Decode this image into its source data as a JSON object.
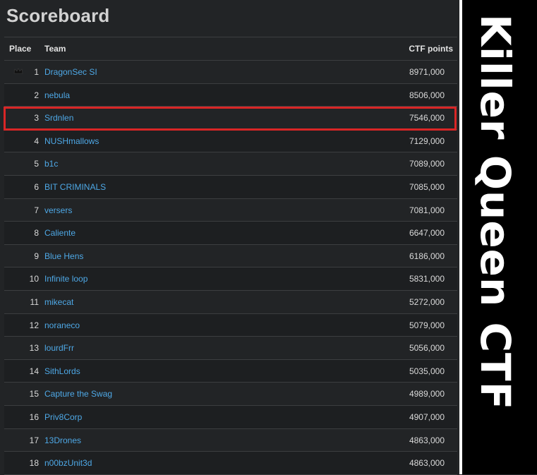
{
  "scoreboard": {
    "title": "Scoreboard",
    "columns": {
      "place": "Place",
      "team": "Team",
      "points": "CTF points"
    },
    "rows": [
      {
        "place": "1",
        "team": "DragonSec SI",
        "points": "8971,000",
        "leader": true
      },
      {
        "place": "2",
        "team": "nebula",
        "points": "8506,000"
      },
      {
        "place": "3",
        "team": "Srdnlen",
        "points": "7546,000",
        "highlighted": true
      },
      {
        "place": "4",
        "team": "NUSHmallows",
        "points": "7129,000"
      },
      {
        "place": "5",
        "team": "b1c",
        "points": "7089,000"
      },
      {
        "place": "6",
        "team": "BIT CRIMINALS",
        "points": "7085,000"
      },
      {
        "place": "7",
        "team": "versers",
        "points": "7081,000"
      },
      {
        "place": "8",
        "team": "Caliente",
        "points": "6647,000"
      },
      {
        "place": "9",
        "team": "Blue Hens",
        "points": "6186,000"
      },
      {
        "place": "10",
        "team": "Infinite loop",
        "points": "5831,000"
      },
      {
        "place": "11",
        "team": "mikecat",
        "points": "5272,000"
      },
      {
        "place": "12",
        "team": "noraneco",
        "points": "5079,000"
      },
      {
        "place": "13",
        "team": "lourdFrr",
        "points": "5056,000"
      },
      {
        "place": "14",
        "team": "SithLords",
        "points": "5035,000"
      },
      {
        "place": "15",
        "team": "Capture the Swag",
        "points": "4989,000"
      },
      {
        "place": "16",
        "team": "Priv8Corp",
        "points": "4907,000"
      },
      {
        "place": "17",
        "team": "13Drones",
        "points": "4863,000"
      },
      {
        "place": "18",
        "team": "n00bzUnit3d",
        "points": "4863,000"
      }
    ]
  },
  "side_banner": {
    "text": "Killer Queen CTF"
  },
  "colors": {
    "background": "#222426",
    "link": "#4ea8e6",
    "highlight_border": "#d92626",
    "banner_background": "#000000",
    "banner_text": "#ffffff"
  },
  "icons": {
    "leader": "crown-icon"
  }
}
